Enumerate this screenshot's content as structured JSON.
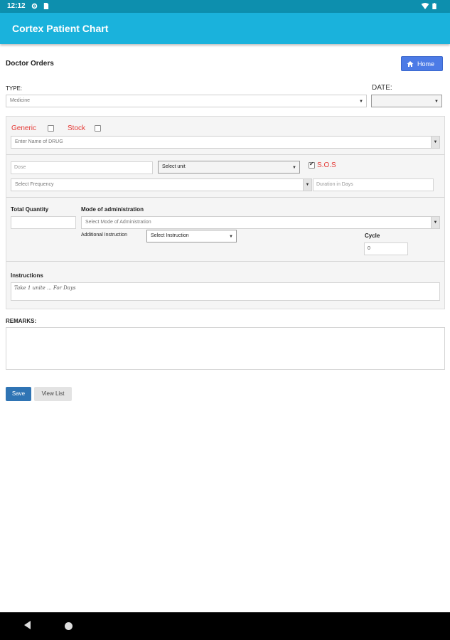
{
  "status_bar": {
    "time": "12:12",
    "icons": [
      "settings-gear-icon",
      "sim-card-icon",
      "wifi-icon",
      "battery-icon"
    ]
  },
  "app_bar": {
    "title": "Cortex Patient Chart"
  },
  "page": {
    "title": "Doctor Orders",
    "home_label": "Home"
  },
  "header_fields": {
    "type_label": "TYPE:",
    "type_value": "Medicine",
    "date_label": "DATE:",
    "date_value": ""
  },
  "drug_section": {
    "generic_label": "Generic",
    "stock_label": "Stock",
    "drug_placeholder": "Enter Name of DRUG",
    "dose_placeholder": "Dose",
    "unit_value": "Select unit",
    "sos_label": "S.O.S",
    "frequency_value": "Select Frequency",
    "duration_placeholder": "Duration in Days"
  },
  "admin_section": {
    "total_quantity_label": "Total Quantity",
    "mode_label": "Mode of administration",
    "mode_value": "Select Mode of Administration",
    "additional_label": "Additional Instruction",
    "additional_value": "Select Instruction",
    "cycle_label": "Cycle",
    "cycle_value": "0"
  },
  "instructions": {
    "label": "Instructions",
    "placeholder": "Take 1 unite ... For Days"
  },
  "remarks": {
    "label": "REMARKS:"
  },
  "actions": {
    "save_label": "Save",
    "view_list_label": "View List"
  },
  "colors": {
    "app_bar": "#1ab2dc",
    "status_bar": "#0d8fae",
    "home_button": "#4c7be6",
    "save_button": "#2f74b4",
    "required_red": "#e53935"
  }
}
